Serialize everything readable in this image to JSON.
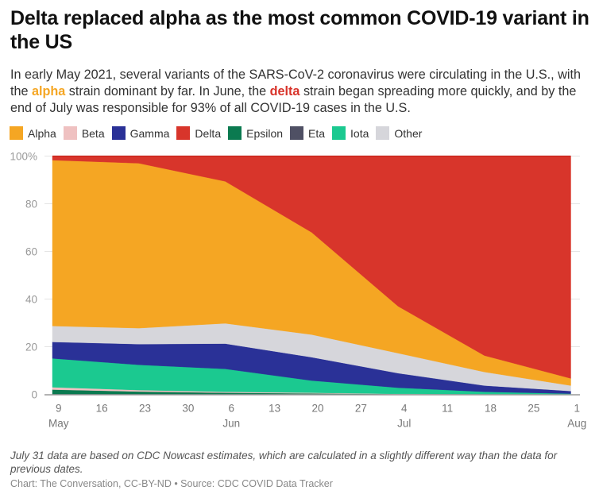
{
  "title": "Delta replaced alpha as the most common COVID-19 variant in the US",
  "subtitle": {
    "part1": "In early May 2021, several variants of the SARS-CoV-2 coronavirus were circulating in the U.S., with the ",
    "alpha_word": "alpha",
    "part2": " strain dominant by far. In June, the ",
    "delta_word": "delta",
    "part3": " strain began spreading more quickly, and by the end of July was responsible for 93% of all COVID-19 cases in the U.S."
  },
  "note": "July 31 data are based on CDC Nowcast estimates, which are calculated in a slightly different way than the data for previous dates.",
  "source": "Chart: The Conversation, CC-BY-ND • Source: CDC COVID Data Tracker",
  "chart_data": {
    "type": "area",
    "stacked": true,
    "normalized": true,
    "x": [
      "2021-05-08",
      "2021-05-22",
      "2021-06-05",
      "2021-06-19",
      "2021-07-03",
      "2021-07-17",
      "2021-07-31"
    ],
    "series": [
      {
        "name": "Eta",
        "color": "#4f5064",
        "values": [
          0.1,
          0.1,
          0.1,
          0.1,
          0.0,
          0.0,
          0.0
        ]
      },
      {
        "name": "Epsilon",
        "color": "#0b7a50",
        "values": [
          1.9,
          1.1,
          0.6,
          0.3,
          0.1,
          0.0,
          0.0
        ]
      },
      {
        "name": "Beta",
        "color": "#efc1c1",
        "values": [
          1.0,
          0.6,
          0.4,
          0.3,
          0.1,
          0.1,
          0.0
        ]
      },
      {
        "name": "Iota",
        "color": "#1bc990",
        "values": [
          12.1,
          10.6,
          9.6,
          5.1,
          2.6,
          1.0,
          0.3
        ]
      },
      {
        "name": "Gamma",
        "color": "#2a3197",
        "values": [
          6.9,
          8.7,
          10.6,
          9.8,
          6.1,
          2.6,
          1.1
        ]
      },
      {
        "name": "Other",
        "color": "#d6d6db",
        "values": [
          6.7,
          6.7,
          8.5,
          9.5,
          8.4,
          5.7,
          2.3
        ]
      },
      {
        "name": "Alpha",
        "color": "#f5a623",
        "values": [
          69.6,
          69.2,
          59.6,
          42.9,
          19.7,
          6.9,
          3.0
        ]
      },
      {
        "name": "Delta",
        "color": "#d8352b",
        "values": [
          1.7,
          3.0,
          10.6,
          32.0,
          63.0,
          83.7,
          93.3
        ]
      }
    ],
    "legend_order": [
      "Alpha",
      "Beta",
      "Gamma",
      "Delta",
      "Epsilon",
      "Eta",
      "Iota",
      "Other"
    ],
    "legend_position": "top-left",
    "title": "Delta replaced alpha as the most common COVID-19 variant in the US",
    "xlabel": "",
    "ylabel": "",
    "ylim": [
      0,
      100
    ],
    "y_ticks": [
      {
        "value": 0,
        "label": "0"
      },
      {
        "value": 20,
        "label": "20"
      },
      {
        "value": 40,
        "label": "40"
      },
      {
        "value": 60,
        "label": "60"
      },
      {
        "value": 80,
        "label": "80"
      },
      {
        "value": 100,
        "label": "100%"
      }
    ],
    "x_range": [
      "2021-05-08",
      "2021-08-01"
    ],
    "x_ticks": [
      {
        "date": "2021-05-09",
        "label": "9",
        "sublabel": "May"
      },
      {
        "date": "2021-05-16",
        "label": "16",
        "sublabel": ""
      },
      {
        "date": "2021-05-23",
        "label": "23",
        "sublabel": ""
      },
      {
        "date": "2021-05-30",
        "label": "30",
        "sublabel": ""
      },
      {
        "date": "2021-06-06",
        "label": "6",
        "sublabel": "Jun"
      },
      {
        "date": "2021-06-13",
        "label": "13",
        "sublabel": ""
      },
      {
        "date": "2021-06-20",
        "label": "20",
        "sublabel": ""
      },
      {
        "date": "2021-06-27",
        "label": "27",
        "sublabel": ""
      },
      {
        "date": "2021-07-04",
        "label": "4",
        "sublabel": "Jul"
      },
      {
        "date": "2021-07-11",
        "label": "11",
        "sublabel": ""
      },
      {
        "date": "2021-07-18",
        "label": "18",
        "sublabel": ""
      },
      {
        "date": "2021-07-25",
        "label": "25",
        "sublabel": ""
      },
      {
        "date": "2021-08-01",
        "label": "1",
        "sublabel": "Aug"
      }
    ],
    "grid": true
  }
}
